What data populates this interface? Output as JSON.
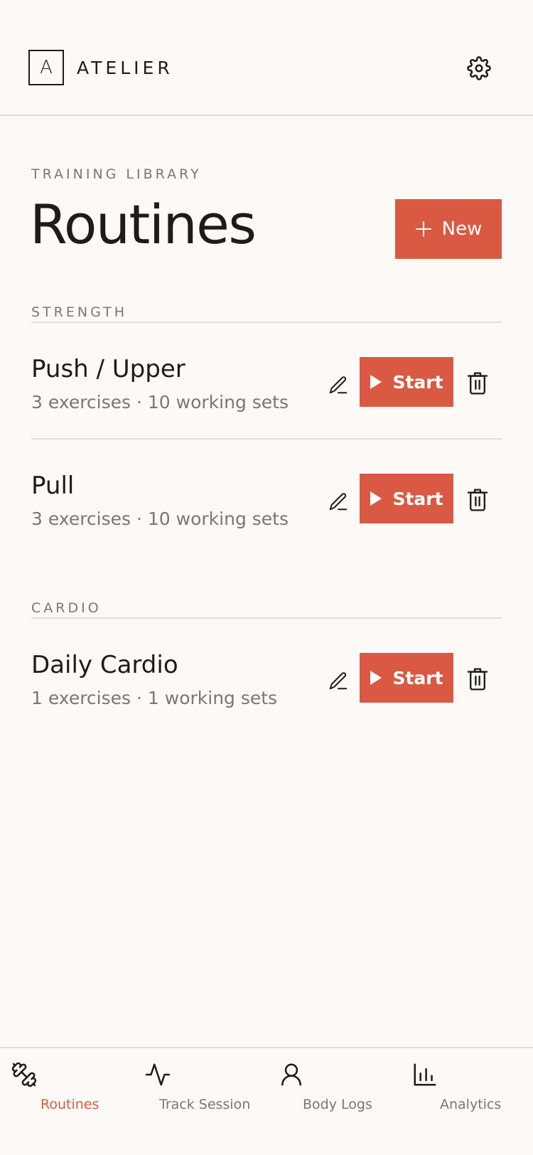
{
  "header": {
    "logo_letter": "A",
    "brand": "ATELIER"
  },
  "page": {
    "eyebrow": "TRAINING LIBRARY",
    "title": "Routines",
    "new_button": "New"
  },
  "sections": [
    {
      "label": "STRENGTH",
      "routines": [
        {
          "name": "Push / Upper",
          "meta": "3 exercises · 10 working sets",
          "start_label": "Start"
        },
        {
          "name": "Pull",
          "meta": "3 exercises · 10 working sets",
          "start_label": "Start"
        }
      ]
    },
    {
      "label": "CARDIO",
      "routines": [
        {
          "name": "Daily Cardio",
          "meta": "1 exercises · 1 working sets",
          "start_label": "Start"
        }
      ]
    }
  ],
  "nav": {
    "items": [
      {
        "label": "Routines",
        "icon": "dumbbell-icon",
        "active": true
      },
      {
        "label": "Track Session",
        "icon": "activity-icon",
        "active": false
      },
      {
        "label": "Body Logs",
        "icon": "user-icon",
        "active": false
      },
      {
        "label": "Analytics",
        "icon": "bar-chart-icon",
        "active": false
      }
    ]
  },
  "colors": {
    "accent": "#d95943",
    "background": "#fdf9f6",
    "text": "#1f1b18",
    "muted": "#7c7672",
    "divider": "#e4dedb"
  }
}
